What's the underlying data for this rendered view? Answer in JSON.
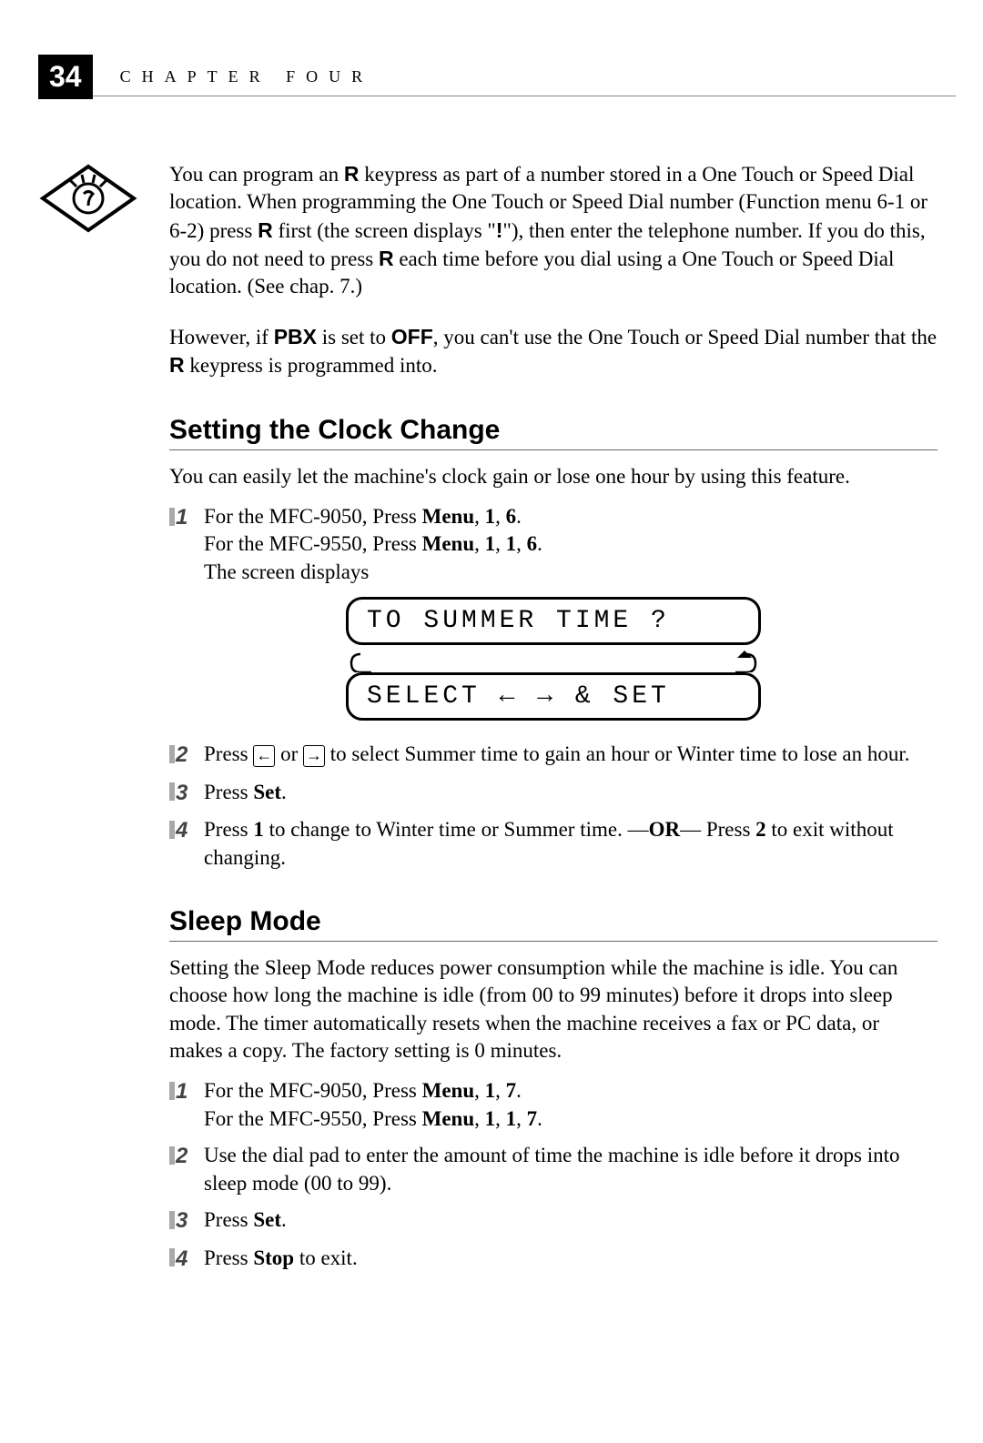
{
  "header": {
    "page_number": "34",
    "chapter_label": "CHAPTER FOUR"
  },
  "tip": {
    "para1_parts": {
      "t1": "You can program an ",
      "b1": "R",
      "t2": " keypress as part of a number stored in a One Touch or Speed Dial location. When programming the One Touch or Speed Dial number (Function menu 6-1 or 6-2) press ",
      "b2": "R",
      "t3": " first (the screen displays \"",
      "b3": "!",
      "t4": "\"), then enter the telephone number. If you do this, you do not need to press ",
      "b4": "R",
      "t5": " each time before you dial using a One Touch or Speed Dial location. (See chap. 7.)"
    },
    "para2_parts": {
      "t1": "However, if ",
      "b1": "PBX",
      "t2": " is set to ",
      "b2": "OFF",
      "t3": ", you can't use the One Touch or Speed Dial number that the ",
      "b3": "R",
      "t4": " keypress is programmed into."
    }
  },
  "section1": {
    "heading": "Setting the Clock Change",
    "intro": "You can easily let the machine's clock gain or lose one hour by using this feature.",
    "step1": {
      "t1": "For the MFC-9050, Press ",
      "b1": "Menu",
      "t2": ", ",
      "b2": "1",
      "t3": ", ",
      "b3": "6",
      "t4": ".",
      "line2_t1": "For the MFC-9550, Press ",
      "line2_b1": "Menu",
      "line2_t2": ", ",
      "line2_b2": "1",
      "line2_t3": ", ",
      "line2_b3": "1",
      "line2_t4": ", ",
      "line2_b4": "6",
      "line2_t5": ".",
      "line3": "The screen displays"
    },
    "lcd": {
      "line1": "TO SUMMER TIME ?",
      "line2": "SELECT ← → & SET"
    },
    "step2": {
      "t1": "Press ",
      "arrow1": "←",
      "t2": " or ",
      "arrow2": "→",
      "t3": " to select Summer time to gain an hour or Winter time to lose an hour."
    },
    "step3": {
      "t1": "Press ",
      "b1": "Set",
      "t2": "."
    },
    "step4": {
      "t1": "Press ",
      "b1": "1",
      "t2": " to change to Winter time or Summer time. —",
      "b2": "OR",
      "t3": "— Press ",
      "b3": "2",
      "t4": " to exit without changing."
    }
  },
  "section2": {
    "heading": "Sleep Mode",
    "intro": "Setting the Sleep Mode reduces power consumption while the machine is idle. You can choose how long the machine is idle (from 00 to 99 minutes) before it drops into sleep mode. The timer automatically resets when the machine receives a fax or PC data, or makes a copy. The factory setting is 0 minutes.",
    "step1": {
      "t1": "For the MFC-9050, Press ",
      "b1": "Menu",
      "t2": ", ",
      "b2": "1",
      "t3": ", ",
      "b3": "7",
      "t4": ".",
      "line2_t1": "For the MFC-9550, Press ",
      "line2_b1": "Menu",
      "line2_t2": ", ",
      "line2_b2": "1",
      "line2_t3": ", ",
      "line2_b3": "1",
      "line2_t4": ", ",
      "line2_b4": "7",
      "line2_t5": "."
    },
    "step2": {
      "t1": "Use the dial pad to enter the amount of time the machine is idle before it drops into sleep mode (00 to 99)."
    },
    "step3": {
      "t1": "Press ",
      "b1": "Set",
      "t2": "."
    },
    "step4": {
      "t1": "Press ",
      "b1": "Stop",
      "t2": " to exit."
    }
  },
  "step_numbers": [
    "1",
    "2",
    "3",
    "4"
  ]
}
